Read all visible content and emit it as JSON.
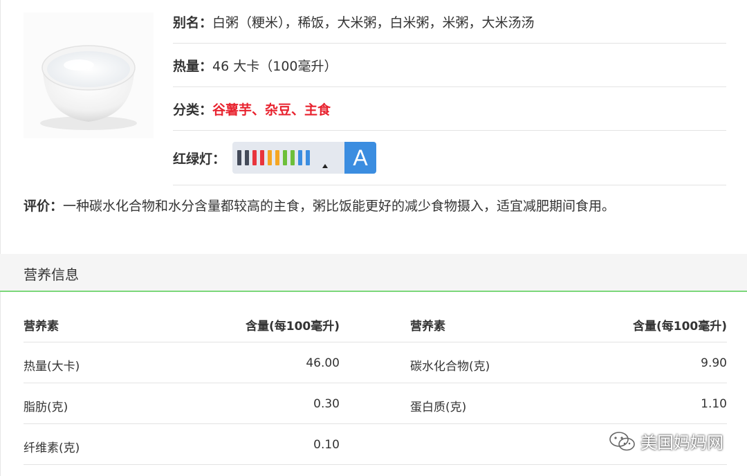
{
  "info": {
    "alias_label": "别名：",
    "alias_value": "白粥（粳米），稀饭，大米粥，白米粥，米粥，大米汤汤",
    "calorie_label": "热量：",
    "calorie_value": "46 大卡（100毫升）",
    "category_label": "分类：",
    "category_value": "谷薯芋、杂豆、主食",
    "traffic_label": "红绿灯：",
    "traffic_grade": "A"
  },
  "traffic_bar_colors": [
    "#444b5a",
    "#444b5a",
    "#e8343c",
    "#e8343c",
    "#f5a623",
    "#f5a623",
    "#6dbf3a",
    "#6dbf3a",
    "#3b8de0",
    "#3b8de0"
  ],
  "evaluation": {
    "label": "评价：",
    "text": "一种碳水化合物和水分含量都较高的主食，粥比饭能更好的减少食物摄入，适宜减肥期间食用。"
  },
  "nutrition": {
    "title": "营养信息",
    "headers": [
      "营养素",
      "含量(每100毫升)",
      "营养素",
      "含量(每100毫升)"
    ],
    "rows": [
      [
        "热量(大卡)",
        "46.00",
        "碳水化合物(克)",
        "9.90"
      ],
      [
        "脂肪(克)",
        "0.30",
        "蛋白质(克)",
        "1.10"
      ],
      [
        "纤维素(克)",
        "0.10",
        "",
        ""
      ]
    ]
  },
  "watermark": {
    "text": "美国妈妈网"
  },
  "colors": {
    "accent_green": "#7bd77a",
    "category_red": "#e8222e",
    "grade_blue": "#3b8de0"
  }
}
